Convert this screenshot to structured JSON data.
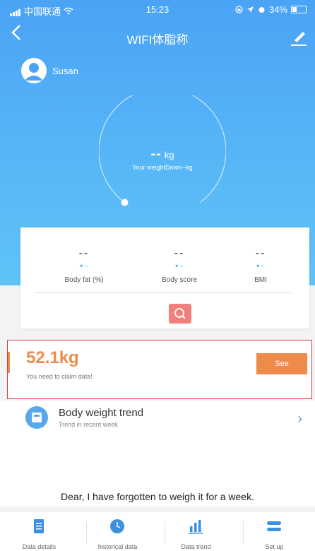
{
  "statusbar": {
    "carrier": "中国联通",
    "time": "15:23",
    "battery": "34%"
  },
  "nav": {
    "title": "WIFI体脂称"
  },
  "profile": {
    "name": "Susan"
  },
  "gauge": {
    "weight": "--",
    "unit": "kg",
    "subtitle": "Your weightDown--kg"
  },
  "metrics": [
    {
      "value": "--",
      "change": "--",
      "label": "Body fat (%)"
    },
    {
      "value": "--",
      "change": "--",
      "label": "Body score"
    },
    {
      "value": "--",
      "change": "--",
      "label": "BMI"
    }
  ],
  "claim": {
    "weight": "52.1kg",
    "message": "You need to claim data!",
    "button": "See"
  },
  "trend": {
    "title": "Body weight trend",
    "subtitle": "Trend in recent week",
    "message": "Dear, I have forgotten to weigh it for a week."
  },
  "tabs": [
    {
      "label": "Data details",
      "icon": "document-icon"
    },
    {
      "label": "historical data",
      "icon": "clock-icon"
    },
    {
      "label": "Data trend",
      "icon": "bar-chart-icon"
    },
    {
      "label": "Set up",
      "icon": "settings-icon"
    }
  ],
  "colors": {
    "primary": "#4aa3f5",
    "accent": "#ef8b4a",
    "highlight": "#e4353c",
    "search": "#f27f7e"
  }
}
